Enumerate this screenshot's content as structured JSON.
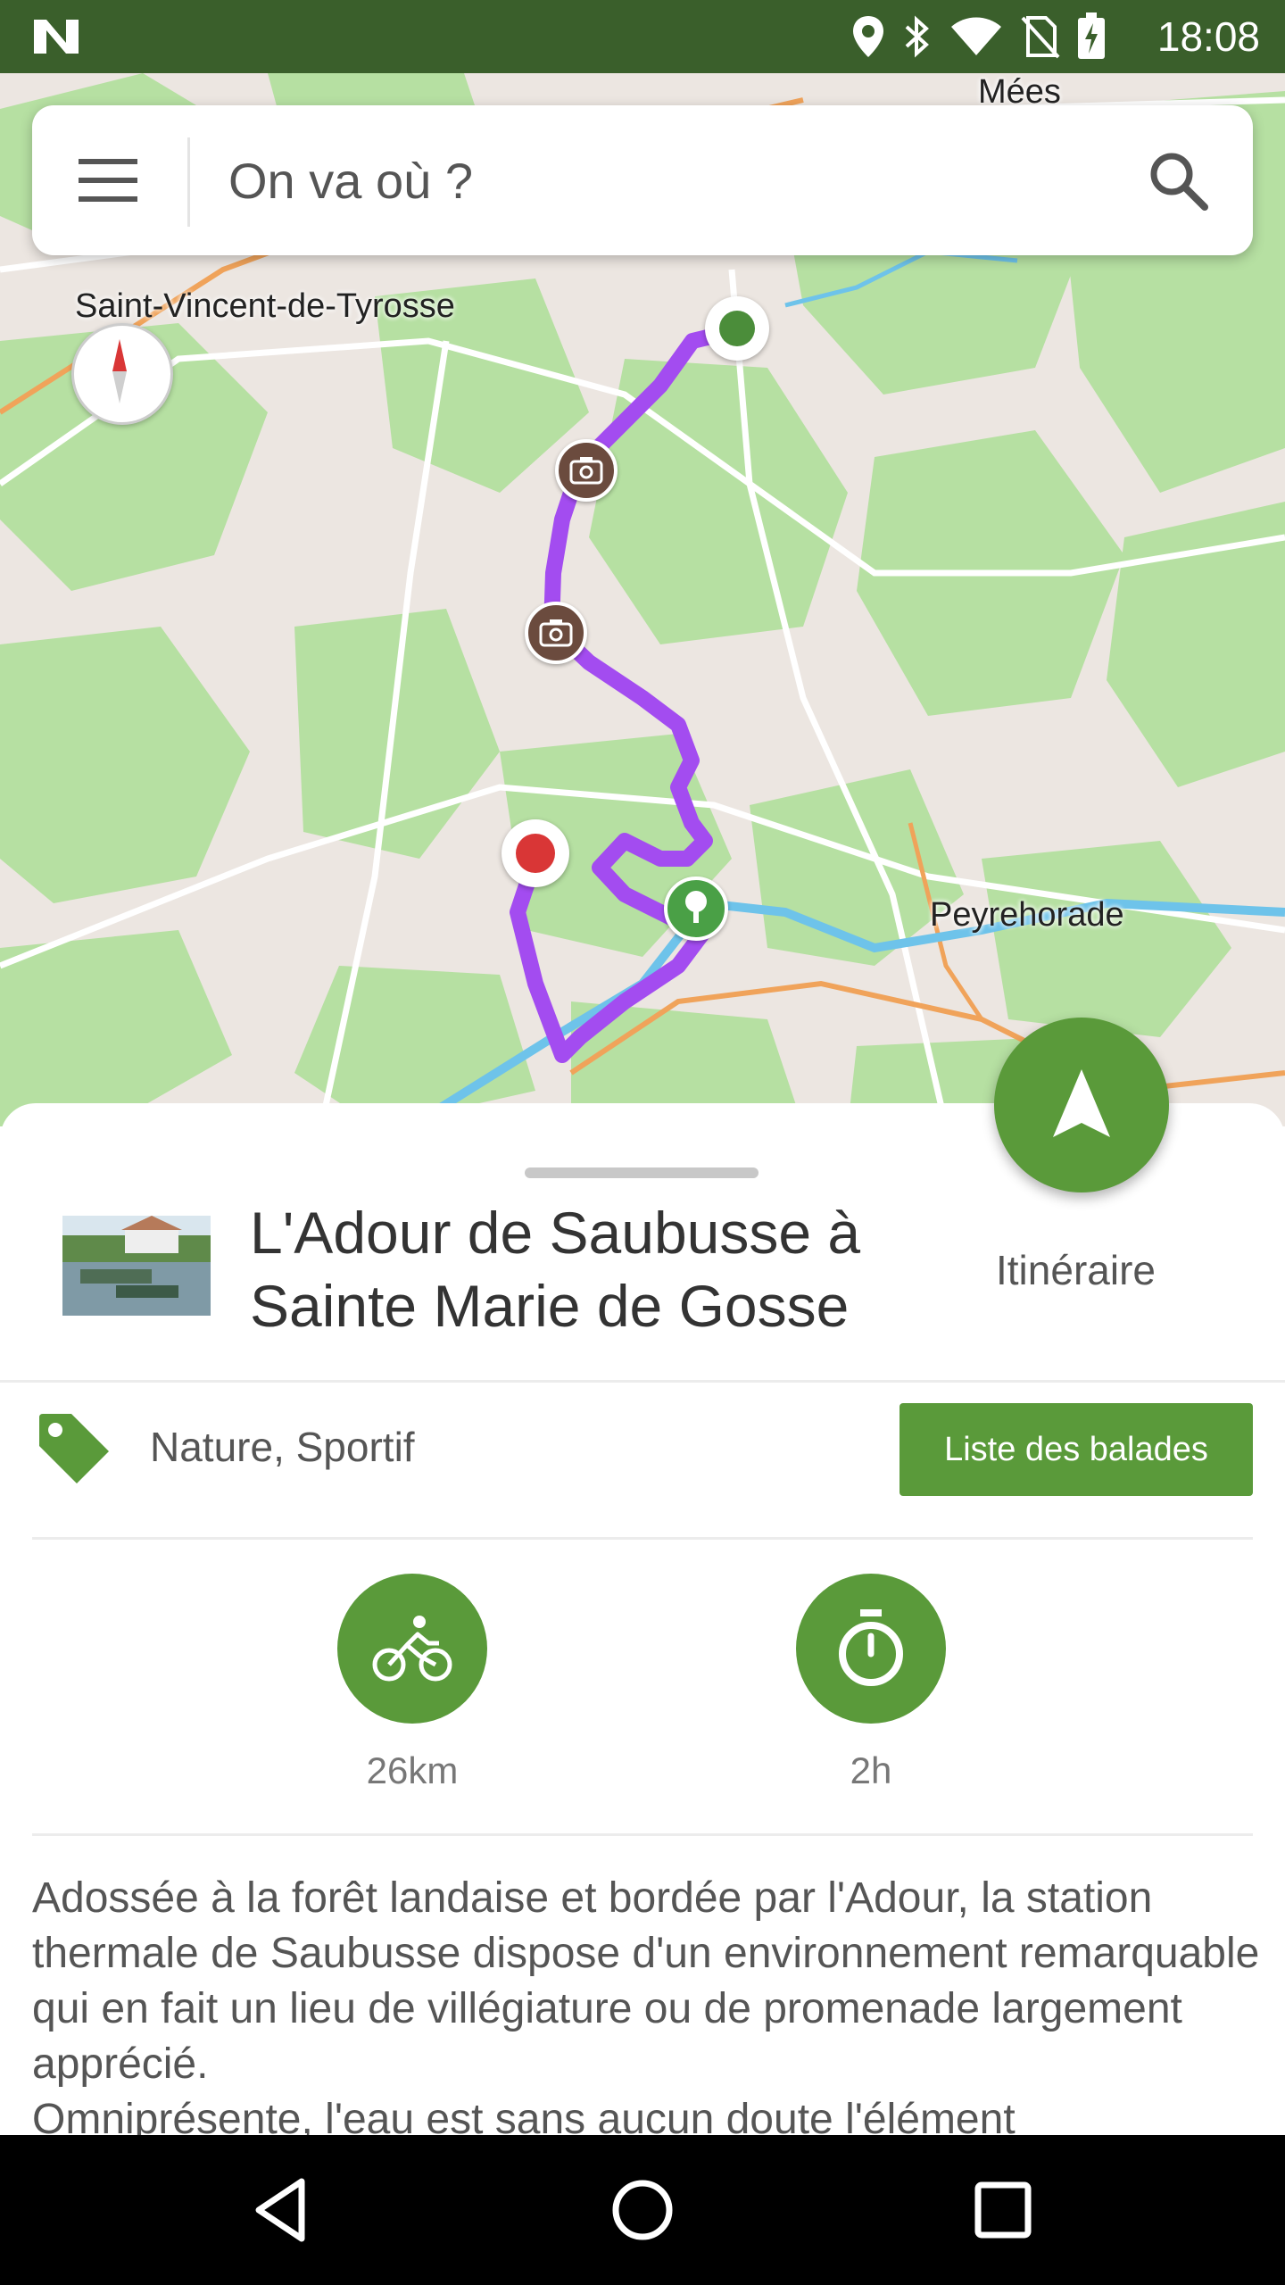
{
  "status_bar": {
    "time": "18:08",
    "icons": [
      "location-icon",
      "bluetooth-icon",
      "wifi-icon",
      "no-sim-icon",
      "battery-charging-icon"
    ]
  },
  "search": {
    "placeholder": "On va où ?"
  },
  "map": {
    "labels": {
      "saint_vincent": "Saint-Vincent-de-Tyrosse",
      "peyrehorade": "Peyrehorade",
      "mees": "Mées"
    },
    "route_color": "#a34cf0",
    "markers": [
      "start-marker",
      "photo-marker",
      "photo-marker",
      "tree-marker",
      "end-marker"
    ]
  },
  "detail": {
    "title": "L'Adour de Saubusse à Sainte Marie de Gosse",
    "itinerary_label": "Itinéraire",
    "tags": "Nature, Sportif",
    "list_button": "Liste des balades",
    "distance": "26km",
    "duration": "2h",
    "description": "Adossée à la forêt landaise et bordée par l'Adour, la station thermale de Saubusse dispose d'un environnement remarquable qui en fait un lieu de villégiature ou de promenade largement apprécié.\nOmniprésente, l'eau est sans aucun doute l'élément"
  },
  "colors": {
    "primary_green": "#5a9a3a",
    "status_bar": "#3a5f2b"
  }
}
